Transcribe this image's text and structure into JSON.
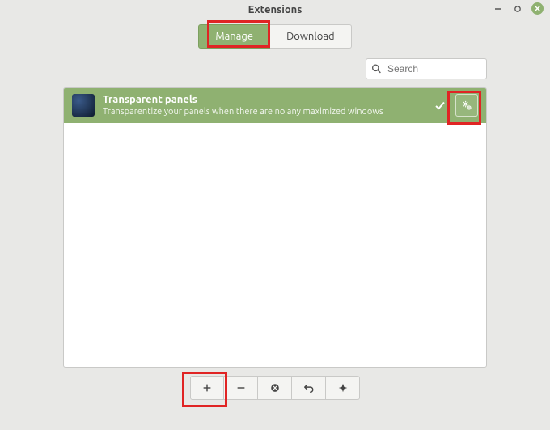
{
  "window": {
    "title": "Extensions"
  },
  "tabs": {
    "manage": "Manage",
    "download": "Download"
  },
  "search": {
    "placeholder": "Search"
  },
  "extensions": [
    {
      "title": "Transparent panels",
      "description": "Transparentize your panels when there are no any maximized windows"
    }
  ],
  "toolbar": {
    "add": "+",
    "remove": "−",
    "delete": "✕",
    "undo": "↶",
    "update": "◆"
  }
}
